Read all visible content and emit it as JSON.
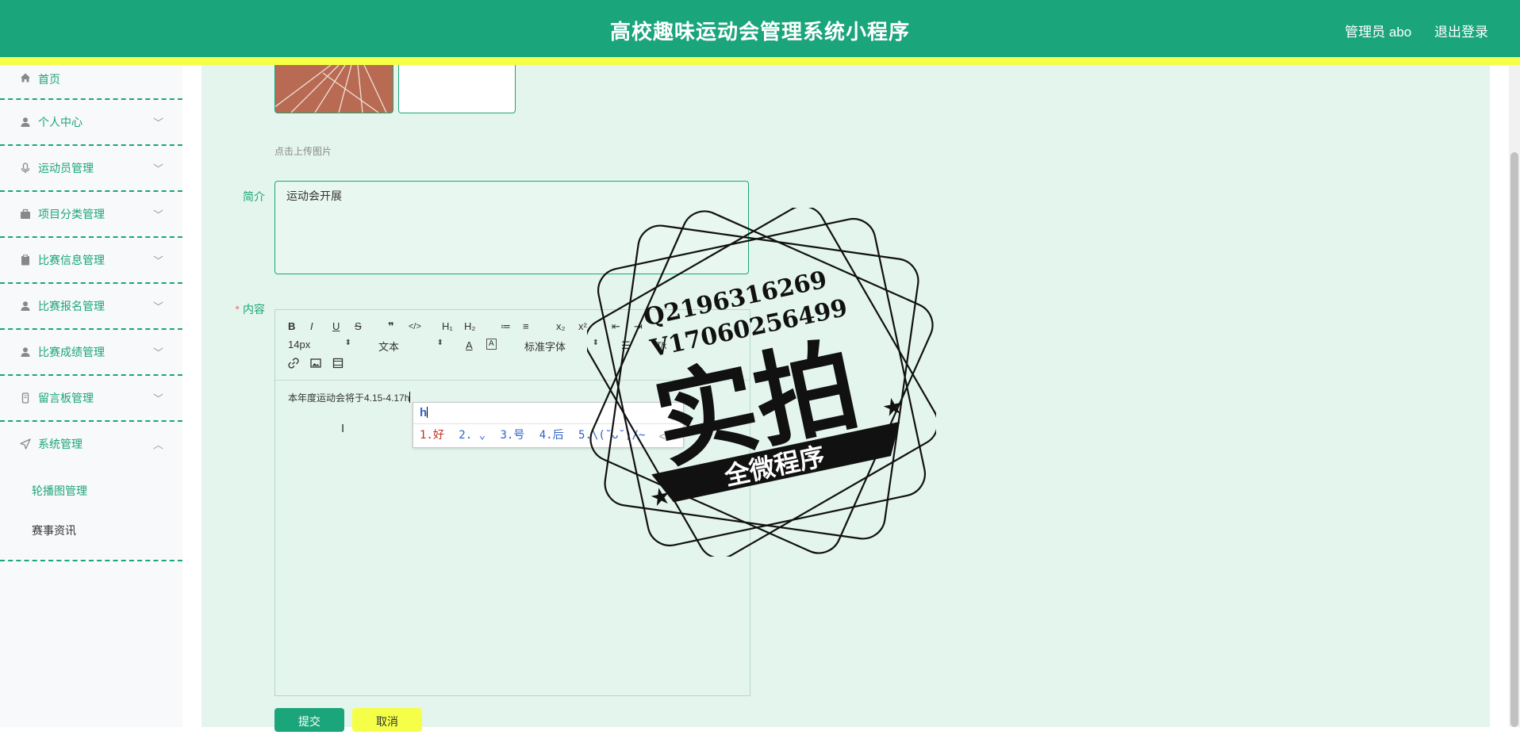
{
  "header": {
    "title": "高校趣味运动会管理系统小程序",
    "admin": "管理员 abo",
    "logout": "退出登录"
  },
  "sidebar": {
    "items": [
      {
        "label": "首页",
        "icon": "home-icon"
      },
      {
        "label": "个人中心",
        "icon": "user-icon"
      },
      {
        "label": "运动员管理",
        "icon": "microphone-icon"
      },
      {
        "label": "项目分类管理",
        "icon": "briefcase-icon"
      },
      {
        "label": "比赛信息管理",
        "icon": "clipboard-icon"
      },
      {
        "label": "比赛报名管理",
        "icon": "user-icon"
      },
      {
        "label": "比赛成绩管理",
        "icon": "user-icon"
      },
      {
        "label": "留言板管理",
        "icon": "phone-icon"
      },
      {
        "label": "系统管理",
        "icon": "send-icon"
      }
    ],
    "submenu": [
      "轮播图管理",
      "赛事资讯"
    ]
  },
  "form": {
    "upload_tip": "点击上传图片",
    "intro_label": "简介",
    "intro_value": "运动会开展",
    "content_label": "内容",
    "required_mark": "*",
    "content_text": "本年度运动会将于4.15-4.17h"
  },
  "toolbar": {
    "bold": "B",
    "italic": "I",
    "underline": "U",
    "strike": "S",
    "quote": "❞",
    "code": "</>",
    "h1": "H₁",
    "h2": "H₂",
    "ol": "≔",
    "ul": "≡",
    "sub": "x₂",
    "sup": "x²",
    "font_size": "14px",
    "text_type": "文本",
    "font_family": "标准字体",
    "clear": "T̸x"
  },
  "ime": {
    "input": "h",
    "candidates": [
      "1.好",
      "2.  ⌄",
      "3.号",
      "4.后",
      "5.\\(˘ᴗ˘)/~"
    ],
    "prev": "<",
    "next": ">"
  },
  "buttons": {
    "submit": "提交",
    "cancel": "取消"
  },
  "watermark": {
    "line1": "Q2196316269",
    "line2": "V17060256499",
    "big": "实拍",
    "banner": "全微程序"
  },
  "colors": {
    "primary": "#1ba57a",
    "accent": "#f6ff47",
    "bg": "#e4f5ee"
  }
}
